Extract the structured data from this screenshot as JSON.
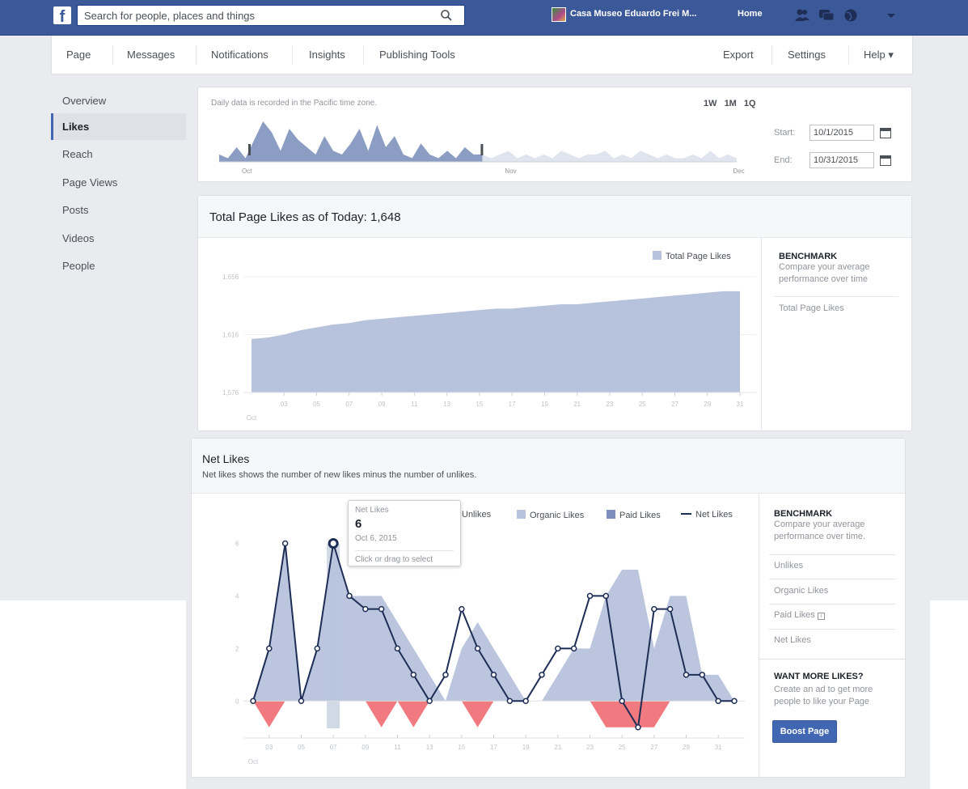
{
  "topbar": {
    "search_placeholder": "Search for people, places and things",
    "page_name": "Casa Museo Eduardo Frei M...",
    "home": "Home"
  },
  "pagenav": {
    "left": [
      "Page",
      "Messages",
      "Notifications",
      "Insights",
      "Publishing Tools"
    ],
    "right": [
      "Export",
      "Settings",
      "Help ▾"
    ]
  },
  "sidebar": {
    "items": [
      "Overview",
      "Likes",
      "Reach",
      "Page Views",
      "Posts",
      "Videos",
      "People"
    ],
    "active": "Likes"
  },
  "range_card": {
    "note": "Daily data is recorded in the Pacific time zone.",
    "ranges": [
      "1W",
      "1M",
      "1Q"
    ],
    "start_label": "Start:",
    "start_value": "10/1/2015",
    "end_label": "End:",
    "end_value": "10/31/2015",
    "timeline_months": [
      "Oct",
      "Nov",
      "Dec"
    ],
    "timeline_values": [
      2,
      1,
      4,
      1,
      6,
      11,
      8,
      3,
      9,
      6,
      4,
      2,
      7,
      3,
      2,
      5,
      9,
      3,
      10,
      4,
      7,
      2,
      1,
      5,
      2,
      1,
      3,
      1,
      4,
      2,
      2,
      1,
      2,
      3,
      1,
      2,
      1,
      2,
      1,
      3,
      2,
      1,
      2,
      2,
      3,
      1,
      2,
      1,
      3,
      2,
      1,
      2,
      1,
      1,
      2,
      1,
      3,
      1,
      2,
      1
    ]
  },
  "total_likes": {
    "title": "Total Page Likes as of Today: 1,648",
    "legend": "Total Page Likes",
    "benchmark_title": "BENCHMARK",
    "benchmark_sub": "Compare your average performance over time",
    "benchmark_items": [
      "Total Page Likes"
    ]
  },
  "net_likes": {
    "title": "Net Likes",
    "subtitle": "Net likes shows the number of new likes minus the number of unlikes.",
    "legend": [
      "Unlikes",
      "Organic Likes",
      "Paid Likes",
      "Net Likes"
    ],
    "benchmark_title": "BENCHMARK",
    "benchmark_sub": "Compare your average performance over time.",
    "benchmark_items": [
      "Unlikes",
      "Organic Likes",
      "Paid Likes",
      "Net Likes"
    ],
    "promo_title": "WANT MORE LIKES?",
    "promo_text": "Create an ad to get more people to like your Page",
    "boost_button": "Boost Page",
    "tooltip": {
      "metric": "Net Likes",
      "value": "6",
      "date": "Oct 6, 2015",
      "hint": "Click or drag to select"
    }
  },
  "chart_data": [
    {
      "type": "area",
      "title": "Total Page Likes as of Today: 1,648",
      "series": [
        {
          "name": "Total Page Likes",
          "values": [
            1613,
            1614,
            1616,
            1619,
            1621,
            1623,
            1624,
            1626,
            1627,
            1628,
            1629,
            1630,
            1631,
            1632,
            1633,
            1634,
            1634,
            1635,
            1636,
            1637,
            1637,
            1638,
            1639,
            1640,
            1641,
            1642,
            1643,
            1644,
            1645,
            1646,
            1646
          ]
        }
      ],
      "x": [
        "Oct 1",
        "Oct 2",
        "Oct 3",
        "Oct 4",
        "Oct 5",
        "Oct 6",
        "Oct 7",
        "Oct 8",
        "Oct 9",
        "Oct 10",
        "Oct 11",
        "Oct 12",
        "Oct 13",
        "Oct 14",
        "Oct 15",
        "Oct 16",
        "Oct 17",
        "Oct 18",
        "Oct 19",
        "Oct 20",
        "Oct 21",
        "Oct 22",
        "Oct 23",
        "Oct 24",
        "Oct 25",
        "Oct 26",
        "Oct 27",
        "Oct 28",
        "Oct 29",
        "Oct 30",
        "Oct 31"
      ],
      "x_ticks": [
        "03",
        "05",
        "07",
        "09",
        "11",
        "13",
        "15",
        "17",
        "19",
        "21",
        "23",
        "25",
        "27",
        "29",
        "31"
      ],
      "x_first_label": "Oct",
      "y_ticks": [
        "1,576",
        "1,616",
        "1,656"
      ],
      "ylim": [
        1576,
        1656
      ]
    },
    {
      "type": "line",
      "title": "Net Likes",
      "x": [
        "Oct 1",
        "Oct 2",
        "Oct 3",
        "Oct 4",
        "Oct 5",
        "Oct 6",
        "Oct 7",
        "Oct 8",
        "Oct 9",
        "Oct 10",
        "Oct 11",
        "Oct 12",
        "Oct 13",
        "Oct 14",
        "Oct 15",
        "Oct 16",
        "Oct 17",
        "Oct 18",
        "Oct 19",
        "Oct 20",
        "Oct 21",
        "Oct 22",
        "Oct 23",
        "Oct 24",
        "Oct 25",
        "Oct 26",
        "Oct 27",
        "Oct 28",
        "Oct 29",
        "Oct 30",
        "Oct 31"
      ],
      "x_ticks": [
        "03",
        "05",
        "07",
        "09",
        "11",
        "13",
        "15",
        "17",
        "19",
        "21",
        "23",
        "25",
        "27",
        "29",
        "31"
      ],
      "x_first_label": "Oct",
      "y_ticks": [
        "0",
        "2",
        "4",
        "6"
      ],
      "ylim": [
        -1.1,
        6.6
      ],
      "series": [
        {
          "name": "Unlikes",
          "values": [
            0,
            -1,
            0,
            0,
            0,
            0,
            0,
            0,
            -1,
            0,
            -1,
            0,
            0,
            0,
            -1,
            0,
            0,
            0,
            0,
            0,
            0,
            0,
            -1,
            -1,
            -1,
            -1,
            0,
            0,
            0,
            0,
            0
          ]
        },
        {
          "name": "Organic Likes",
          "values": [
            0,
            2,
            6,
            0,
            2,
            6,
            4,
            4,
            4,
            3,
            2,
            1,
            0,
            2,
            3,
            2,
            1,
            0,
            0,
            1,
            2,
            2,
            4,
            5,
            5,
            2,
            4,
            4,
            1,
            1,
            0
          ]
        },
        {
          "name": "Paid Likes",
          "values": [
            0,
            0,
            0,
            0,
            0,
            0,
            0,
            0,
            0,
            0,
            0,
            0,
            0,
            0,
            0,
            0,
            0,
            0,
            0,
            0,
            0,
            0,
            0,
            0,
            0,
            0,
            0,
            0,
            0,
            0,
            0
          ]
        },
        {
          "name": "Net Likes",
          "values": [
            0,
            2,
            6,
            0,
            2,
            6,
            4,
            3.5,
            3.5,
            2,
            1,
            0,
            1,
            3.5,
            2,
            1,
            0,
            0,
            1,
            2,
            2,
            4,
            4,
            0,
            -1,
            3.5,
            3.5,
            1,
            1,
            0,
            0
          ]
        }
      ],
      "selected_index": 5
    }
  ]
}
